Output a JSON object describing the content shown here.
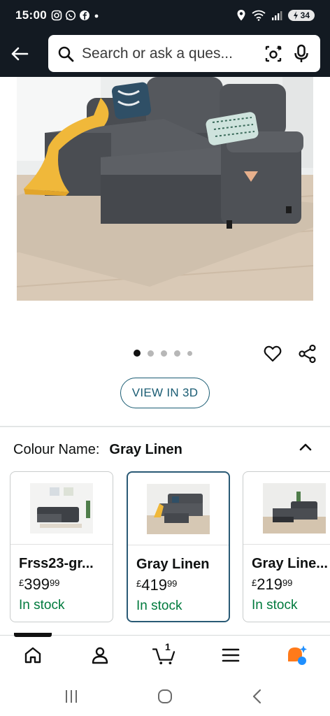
{
  "status_bar": {
    "time": "15:00",
    "battery": "34",
    "left_icons": [
      "instagram-icon",
      "whatsapp-icon",
      "facebook-icon",
      "dot-icon"
    ],
    "right_icons": [
      "location-icon",
      "wifi-icon",
      "signal-icon",
      "battery-icon"
    ]
  },
  "header": {
    "search_placeholder": "Search or ask a ques..."
  },
  "gallery": {
    "dot_count": 5,
    "active_index": 0
  },
  "view3d_label": "VIEW IN 3D",
  "colour": {
    "label": "Colour Name:",
    "value": "Gray Linen"
  },
  "variants": [
    {
      "name": "Frss23-gr...",
      "currency": "£",
      "price_whole": "399",
      "price_fraction": "99",
      "stock": "In stock",
      "selected": false
    },
    {
      "name": "Gray Linen",
      "currency": "£",
      "price_whole": "419",
      "price_fraction": "99",
      "stock": "In stock",
      "selected": true
    },
    {
      "name": "Gray Line...",
      "currency": "£",
      "price_whole": "219",
      "price_fraction": "99",
      "stock": "In stock",
      "selected": false
    }
  ],
  "bottom_nav": {
    "items": [
      "home-icon",
      "account-icon",
      "cart-icon",
      "menu-icon",
      "rufus-icon"
    ],
    "cart_count": "1"
  },
  "colors": {
    "header_bg": "#131a22",
    "accent_teal": "#1a5c73",
    "stock_green": "#007a3d",
    "rufus_orange": "#ff7a1a",
    "rufus_blue": "#1f8fff"
  }
}
